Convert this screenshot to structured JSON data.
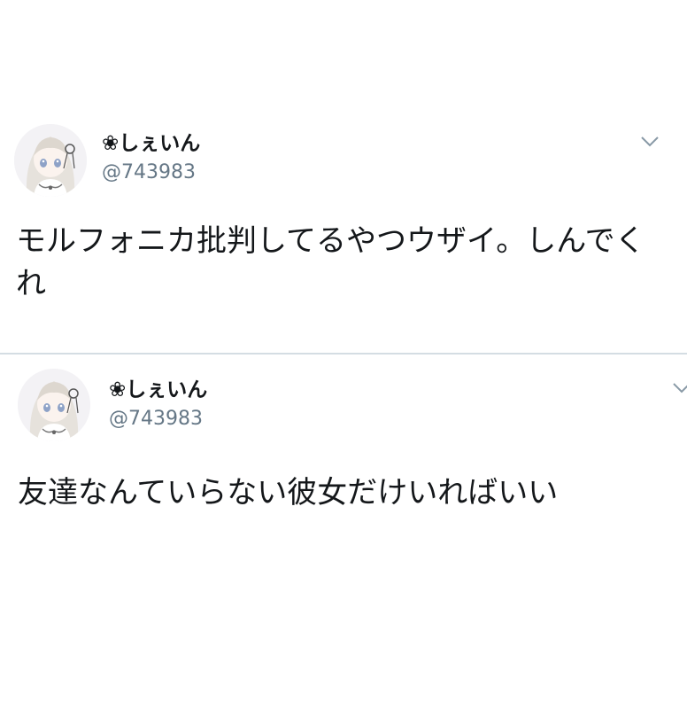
{
  "tweets": [
    {
      "display_name": "❀しぇいん",
      "handle": "@743983",
      "text": "モルフォニカ批判してるやつウザイ。しんでくれ",
      "avatar_icon": "avatar-anime-girl-icon",
      "menu_icon": "chevron-down-icon"
    },
    {
      "display_name": "❀しぇいん",
      "handle": "@743983",
      "text": "友達なんていらない彼女だけいればいい",
      "avatar_icon": "avatar-anime-girl-icon",
      "menu_icon": "chevron-down-icon"
    }
  ],
  "colors": {
    "text": "#14171a",
    "handle": "#657786",
    "divider": "#d4dde3",
    "caret": "#8899a6"
  }
}
